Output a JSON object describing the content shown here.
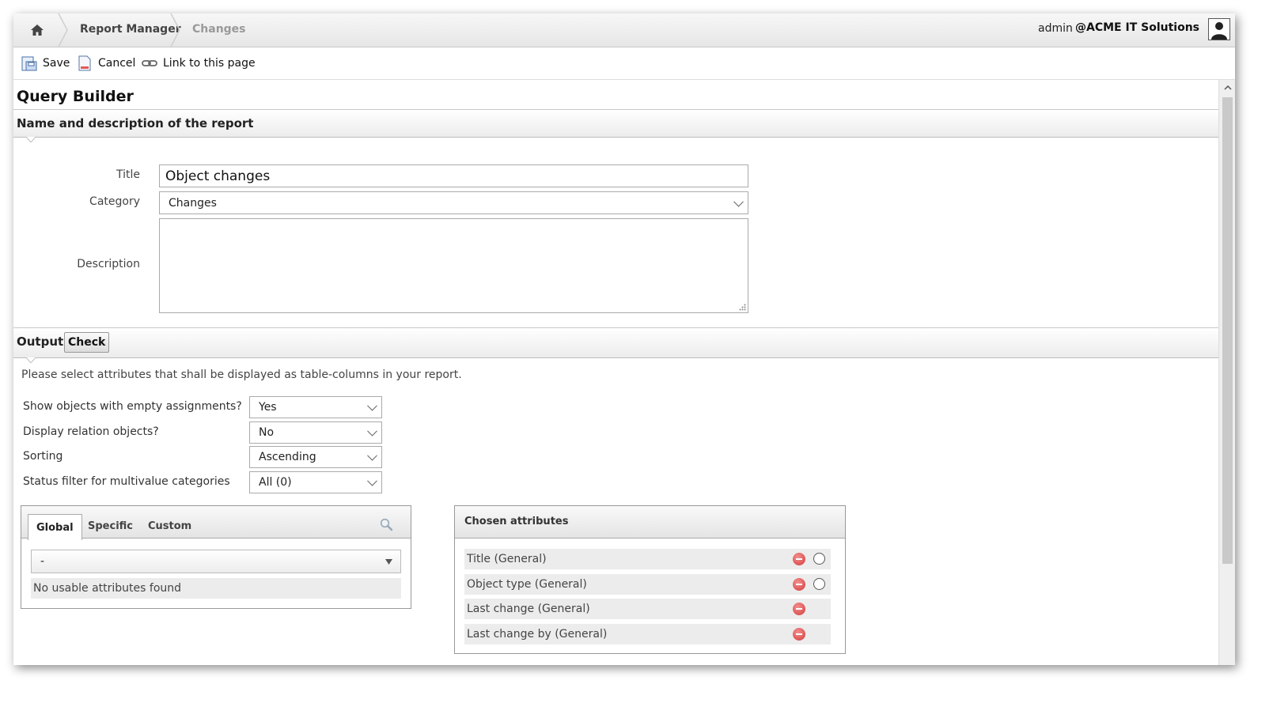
{
  "topbar": {
    "home_icon": "home-icon",
    "breadcrumb": [
      "Report Manager",
      "Changes"
    ],
    "user": "admin",
    "company": "@ACME IT Solutions",
    "avatar_icon": "user-avatar-icon"
  },
  "toolbar": {
    "save_label": "Save",
    "cancel_label": "Cancel",
    "link_label": "Link to this page"
  },
  "page": {
    "title": "Query Builder"
  },
  "name_section": {
    "heading": "Name and description of the report",
    "title_label": "Title",
    "title_value": "Object changes",
    "category_label": "Category",
    "category_value": "Changes",
    "description_label": "Description",
    "description_value": ""
  },
  "output_section": {
    "heading": "Output:",
    "check_label": "Check",
    "hint": "Please select attributes that shall be displayed as table-columns in your report.",
    "options": [
      {
        "label": "Show objects with empty assignments?",
        "value": "Yes"
      },
      {
        "label": "Display relation objects?",
        "value": "No"
      },
      {
        "label": "Sorting",
        "value": "Ascending"
      },
      {
        "label": "Status filter for multivalue categories",
        "value": "All (0)"
      }
    ]
  },
  "attribute_browser": {
    "tabs": [
      "Global",
      "Specific",
      "Custom"
    ],
    "active_tab": "Global",
    "select_value": "-",
    "empty_message": "No usable attributes found"
  },
  "chosen_attributes": {
    "heading": "Chosen attributes",
    "items": [
      {
        "label": "Title (General)",
        "radio": true
      },
      {
        "label": "Object type (General)",
        "radio": true
      },
      {
        "label": "Last change (General)",
        "radio": false
      },
      {
        "label": "Last change by (General)",
        "radio": false
      }
    ]
  },
  "colors": {
    "remove_button": "#d23b3b",
    "section_border": "#bdbdbd"
  }
}
